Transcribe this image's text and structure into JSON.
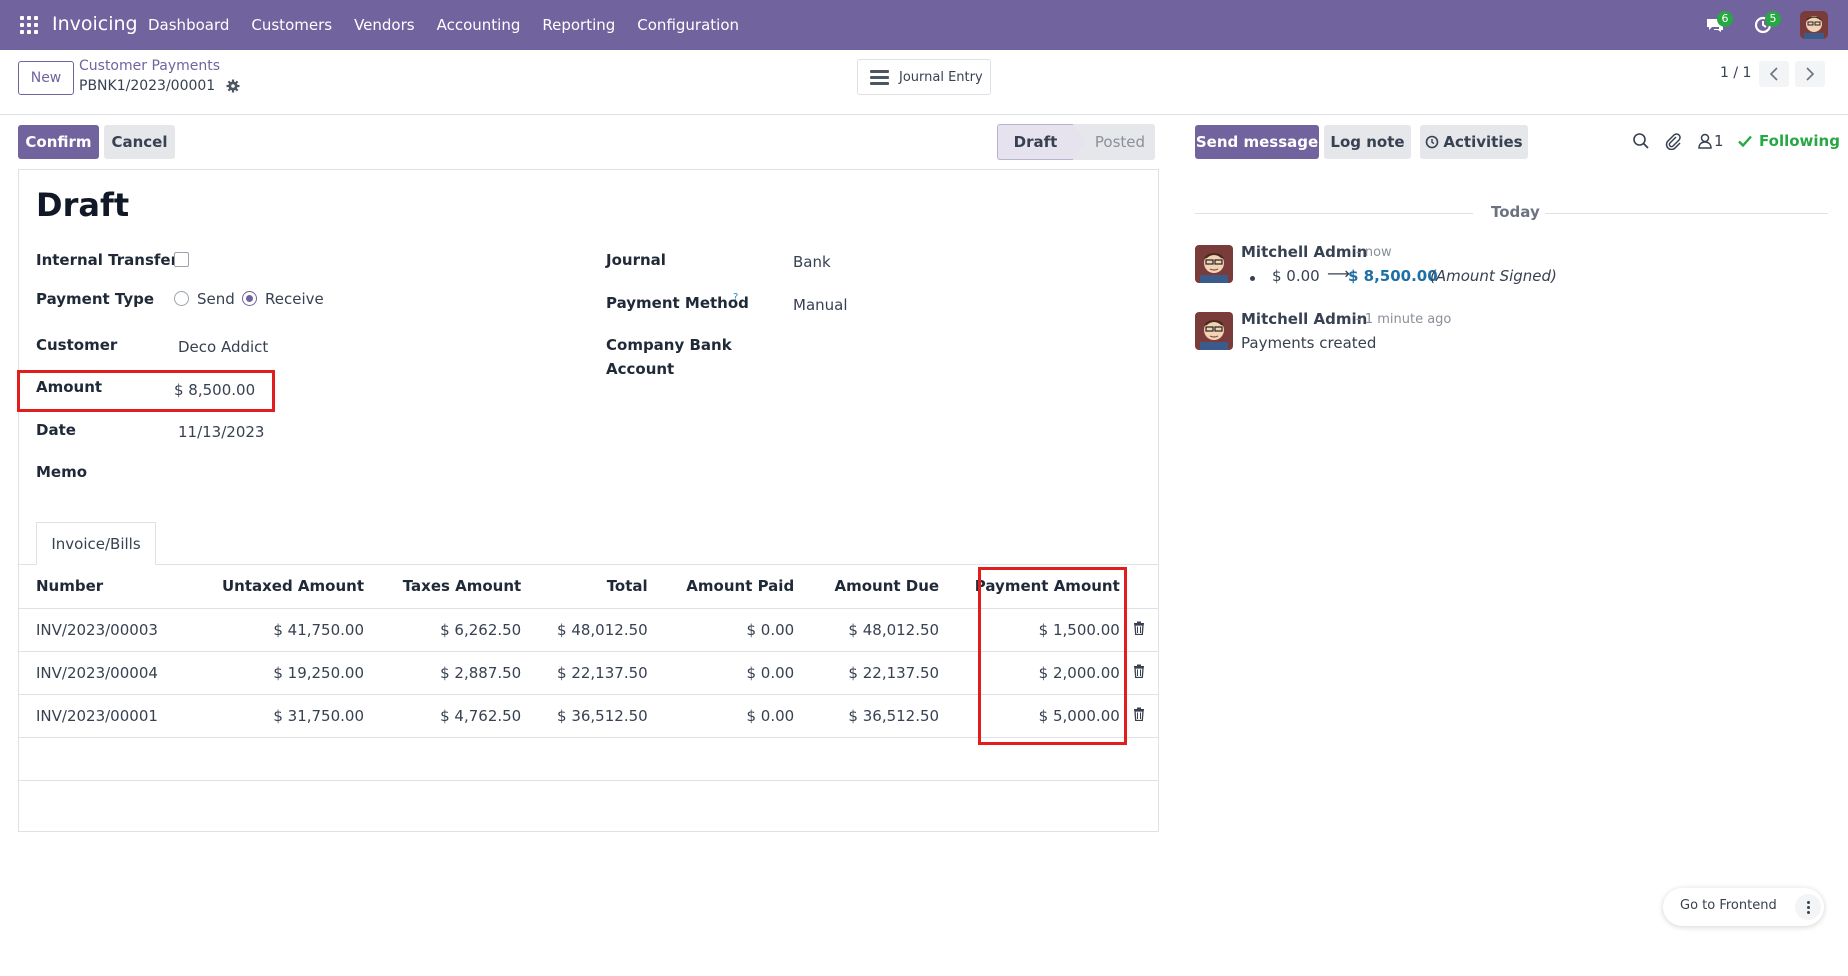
{
  "navbar": {
    "app_name": "Invoicing",
    "menu": [
      "Dashboard",
      "Customers",
      "Vendors",
      "Accounting",
      "Reporting",
      "Configuration"
    ],
    "messages_badge": "6",
    "activities_badge": "5",
    "bg_color": "#71639e"
  },
  "control_panel": {
    "new_label": "New",
    "breadcrumb_parent": "Customer Payments",
    "breadcrumb_current": "PBNK1/2023/00001",
    "journal_entry_label": "Journal Entry",
    "pager": "1 / 1"
  },
  "statusbar": {
    "confirm_label": "Confirm",
    "cancel_label": "Cancel",
    "stages": [
      "Draft",
      "Posted"
    ],
    "current_stage": "Draft"
  },
  "form": {
    "title": "Draft",
    "internal_transfer_label": "Internal Transfer",
    "internal_transfer_checked": false,
    "payment_type_label": "Payment Type",
    "payment_type_options": [
      "Send",
      "Receive"
    ],
    "payment_type_selected": "Receive",
    "customer_label": "Customer",
    "customer_value": "Deco Addict",
    "amount_label": "Amount",
    "amount_value": "$ 8,500.00",
    "date_label": "Date",
    "date_value": "11/13/2023",
    "memo_label": "Memo",
    "journal_label": "Journal",
    "journal_value": "Bank",
    "payment_method_label": "Payment Method",
    "payment_method_help": "?",
    "payment_method_value": "Manual",
    "company_bank_label_1": "Company Bank",
    "company_bank_label_2": "Account"
  },
  "tab": {
    "label": "Invoice/Bills"
  },
  "lines": {
    "headers": [
      "Number",
      "Untaxed Amount",
      "Taxes Amount",
      "Total",
      "Amount Paid",
      "Amount Due",
      "Payment Amount"
    ],
    "rows": [
      [
        "INV/2023/00003",
        "$ 41,750.00",
        "$ 6,262.50",
        "$ 48,012.50",
        "$ 0.00",
        "$ 48,012.50",
        "$ 1,500.00"
      ],
      [
        "INV/2023/00004",
        "$ 19,250.00",
        "$ 2,887.50",
        "$ 22,137.50",
        "$ 0.00",
        "$ 22,137.50",
        "$ 2,000.00"
      ],
      [
        "INV/2023/00001",
        "$ 31,750.00",
        "$ 4,762.50",
        "$ 36,512.50",
        "$ 0.00",
        "$ 36,512.50",
        "$ 5,000.00"
      ]
    ]
  },
  "chatter": {
    "send_message_label": "Send message",
    "log_note_label": "Log note",
    "activities_label": "Activities",
    "followers_count": "1",
    "following_label": "Following",
    "today_label": "Today",
    "messages": [
      {
        "author": "Mitchell Admin",
        "time": "- now",
        "old_value": "$ 0.00",
        "new_value": "$ 8,500.00",
        "field": "(Amount Signed)"
      },
      {
        "author": "Mitchell Admin",
        "time": "- 1 minute ago",
        "body": "Payments created"
      }
    ]
  },
  "frontend_label": "Go to Frontend",
  "highlight_color": "#e11d1d"
}
